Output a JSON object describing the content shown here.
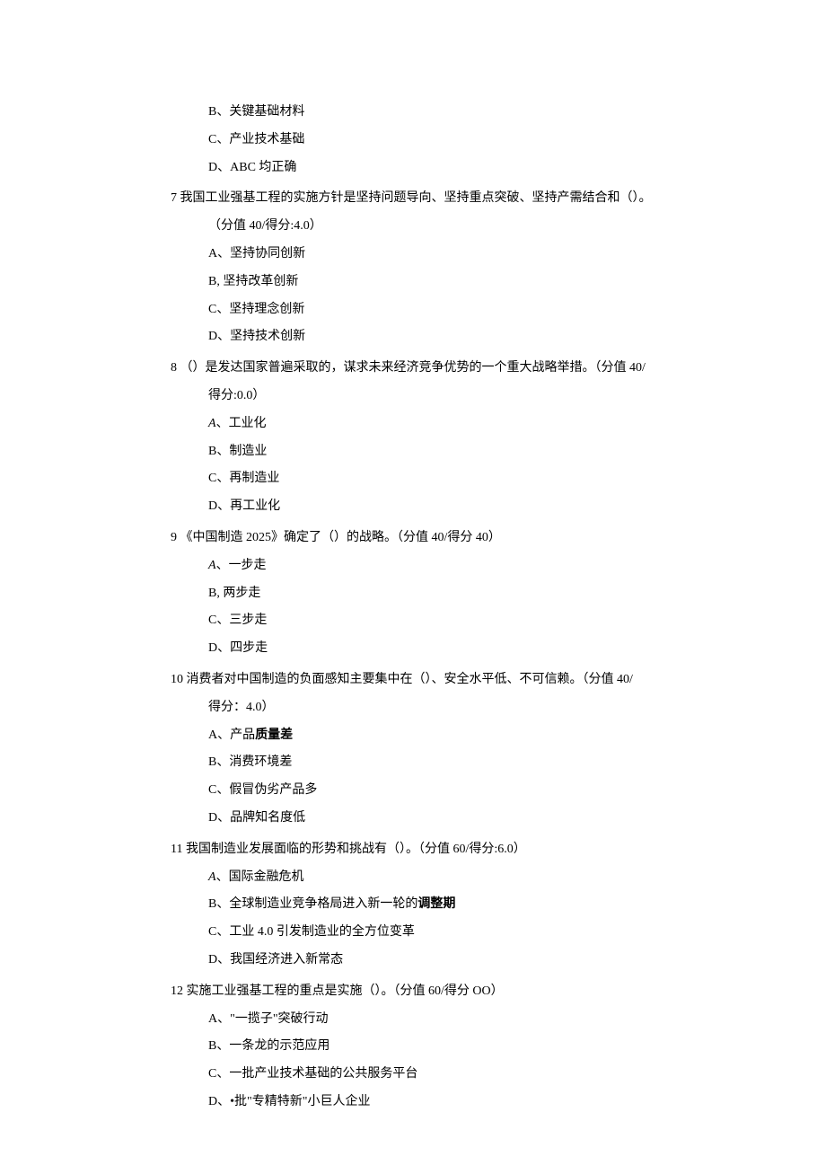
{
  "orphan_options": [
    {
      "label": "B、",
      "text": "关键基础材料"
    },
    {
      "label": "C、",
      "text": "产业技术基础"
    },
    {
      "label": "D、",
      "text": "ABC 均正确"
    }
  ],
  "questions": [
    {
      "num": "7",
      "text": " 我国工业强基工程的实施方针是坚持问题导向、坚持重点突破、坚持产需结合和（）。",
      "score": "（分值 40/得分:4.0）",
      "score_inline": false,
      "options": [
        {
          "label": "A、",
          "text": "坚持协同创新"
        },
        {
          "label": "B, ",
          "text": "坚持改革创新"
        },
        {
          "label": "C、",
          "text": "坚持理念创新"
        },
        {
          "label": "D、",
          "text": "坚持技术创新"
        }
      ]
    },
    {
      "num": "8",
      "text": " （）是发达国家普遍采取的，谋求未来经济竞争优势的一个重大战略举措。（分值 40/",
      "score": "得分:0.0）",
      "score_inline": false,
      "options": [
        {
          "label_italic": "A",
          "label_rest": "、",
          "text": "工业化"
        },
        {
          "label": "B、",
          "text": "制造业"
        },
        {
          "label": "C、",
          "text": "再制造业"
        },
        {
          "label": "D、",
          "text": "再工业化"
        }
      ]
    },
    {
      "num": "9",
      "text": " 《中国制造 2025》确定了（）的战略。（分值 40/得分 40）",
      "score": "",
      "score_inline": true,
      "options": [
        {
          "label_italic": "A",
          "label_rest": "、",
          "text": "一步走"
        },
        {
          "label": "B, ",
          "text": "两步走"
        },
        {
          "label": "C、",
          "text": "三步走"
        },
        {
          "label": "D、",
          "text": "四步走"
        }
      ]
    },
    {
      "num": "10",
      "text": " 消费者对中国制造的负面感知主要集中在（）、安全水平低、不可信赖。（分值 40/",
      "score": "得分：4.0）",
      "score_inline": false,
      "options": [
        {
          "label": "A、",
          "text_pre": "产品",
          "text_bold": "质量差"
        },
        {
          "label": "B、",
          "text": "消费环境差"
        },
        {
          "label": "C、",
          "text": "假冒伪劣产品多"
        },
        {
          "label": "D、",
          "text": "品牌知名度低"
        }
      ]
    },
    {
      "num": "11",
      "text": " 我国制造业发展面临的形势和挑战有（）。（分值 60/得分:6.0）",
      "score": "",
      "score_inline": true,
      "options": [
        {
          "label_italic": "A",
          "label_rest": "、",
          "text": "国际金融危机"
        },
        {
          "label": "B、",
          "text_pre": "全球制造业竞争格局进入新一轮的",
          "text_bold": "调整期"
        },
        {
          "label": "C、",
          "text": "工业 4.0 引发制造业的全方位变革"
        },
        {
          "label": "D、",
          "text": "我国经济进入新常态"
        }
      ]
    },
    {
      "num": "12",
      "text": " 实施工业强基工程的重点是实施（）。（分值 60/得分 OO）",
      "score": "",
      "score_inline": true,
      "options": [
        {
          "label": "A、",
          "text": "\"一揽子\"突破行动"
        },
        {
          "label": "B、",
          "text": "一条龙的示范应用"
        },
        {
          "label": "C、",
          "text": "一批产业技术基础的公共服务平台"
        },
        {
          "label": "D、",
          "text": "•批\"专精特新\"小巨人企业"
        }
      ]
    }
  ]
}
